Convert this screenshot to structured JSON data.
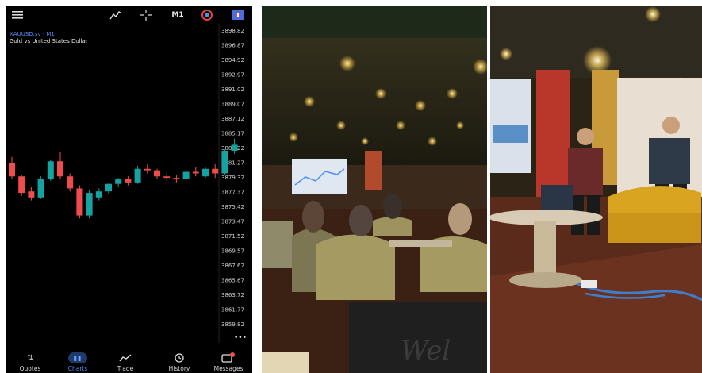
{
  "app": {
    "symbol": "XAUUSD.sv · M1",
    "description": "Gold vs United States Dollar",
    "timeframe": "M1",
    "up_color": "#16a2a0",
    "down_color": "#ef4d4d",
    "accent": "#4f8df5"
  },
  "toolbar": {
    "icons": [
      "menu-icon",
      "indicator-icon",
      "crosshair-icon",
      "objects-icon",
      "flag-icon"
    ]
  },
  "chart_data": {
    "type": "candlestick",
    "y_ticks": [
      "3898.82",
      "3896.87",
      "3894.92",
      "3892.97",
      "3891.02",
      "3889.07",
      "3887.12",
      "3885.17",
      "3883.22",
      "3881.27",
      "3879.32",
      "3877.37",
      "3875.42",
      "3873.47",
      "3871.52",
      "3869.57",
      "3867.62",
      "3865.67",
      "3863.72",
      "3861.77",
      "3859.82"
    ],
    "ylim": [
      3859.82,
      3898.82
    ],
    "candles": [
      {
        "o": 3881.2,
        "h": 3882.0,
        "c": 3879.4,
        "l": 3879.0
      },
      {
        "o": 3879.4,
        "h": 3879.6,
        "c": 3877.2,
        "l": 3876.8
      },
      {
        "o": 3877.4,
        "h": 3878.0,
        "c": 3876.6,
        "l": 3876.2
      },
      {
        "o": 3876.6,
        "h": 3879.4,
        "c": 3879.0,
        "l": 3876.4
      },
      {
        "o": 3879.0,
        "h": 3881.6,
        "c": 3881.4,
        "l": 3878.8
      },
      {
        "o": 3881.4,
        "h": 3882.6,
        "c": 3879.4,
        "l": 3879.0
      },
      {
        "o": 3879.4,
        "h": 3879.8,
        "c": 3877.8,
        "l": 3877.4
      },
      {
        "o": 3877.8,
        "h": 3878.2,
        "c": 3874.2,
        "l": 3873.8
      },
      {
        "o": 3874.2,
        "h": 3877.6,
        "c": 3877.2,
        "l": 3873.8
      },
      {
        "o": 3876.6,
        "h": 3877.8,
        "c": 3877.4,
        "l": 3876.2
      },
      {
        "o": 3877.4,
        "h": 3878.6,
        "c": 3878.4,
        "l": 3877.0
      },
      {
        "o": 3878.4,
        "h": 3879.2,
        "c": 3879.0,
        "l": 3878.0
      },
      {
        "o": 3879.0,
        "h": 3879.4,
        "c": 3878.6,
        "l": 3878.2
      },
      {
        "o": 3878.6,
        "h": 3880.8,
        "c": 3880.4,
        "l": 3878.4
      },
      {
        "o": 3880.4,
        "h": 3881.0,
        "c": 3880.2,
        "l": 3879.8
      },
      {
        "o": 3880.2,
        "h": 3880.4,
        "c": 3879.4,
        "l": 3879.0
      },
      {
        "o": 3879.4,
        "h": 3879.8,
        "c": 3879.2,
        "l": 3878.8
      },
      {
        "o": 3879.2,
        "h": 3879.6,
        "c": 3879.0,
        "l": 3878.6
      },
      {
        "o": 3879.0,
        "h": 3880.4,
        "c": 3880.0,
        "l": 3878.8
      },
      {
        "o": 3880.0,
        "h": 3880.6,
        "c": 3879.8,
        "l": 3879.4
      },
      {
        "o": 3879.4,
        "h": 3880.6,
        "c": 3880.4,
        "l": 3879.2
      },
      {
        "o": 3880.4,
        "h": 3881.0,
        "c": 3879.8,
        "l": 3879.2
      },
      {
        "o": 3879.8,
        "h": 3883.0,
        "c": 3882.8,
        "l": 3879.6
      },
      {
        "o": 3882.8,
        "h": 3884.4,
        "c": 3883.6,
        "l": 3882.4
      }
    ]
  },
  "nav": {
    "items": [
      {
        "label": "Quotes",
        "icon": "quotes-icon"
      },
      {
        "label": "Charts",
        "icon": "charts-icon"
      },
      {
        "label": "Trade",
        "icon": "trade-icon"
      },
      {
        "label": "History",
        "icon": "history-icon"
      },
      {
        "label": "Messages",
        "icon": "messages-icon"
      }
    ],
    "active": "Charts"
  },
  "photos": [
    {
      "name": "cafe-audience-photo"
    },
    {
      "name": "presenters-photo"
    }
  ]
}
